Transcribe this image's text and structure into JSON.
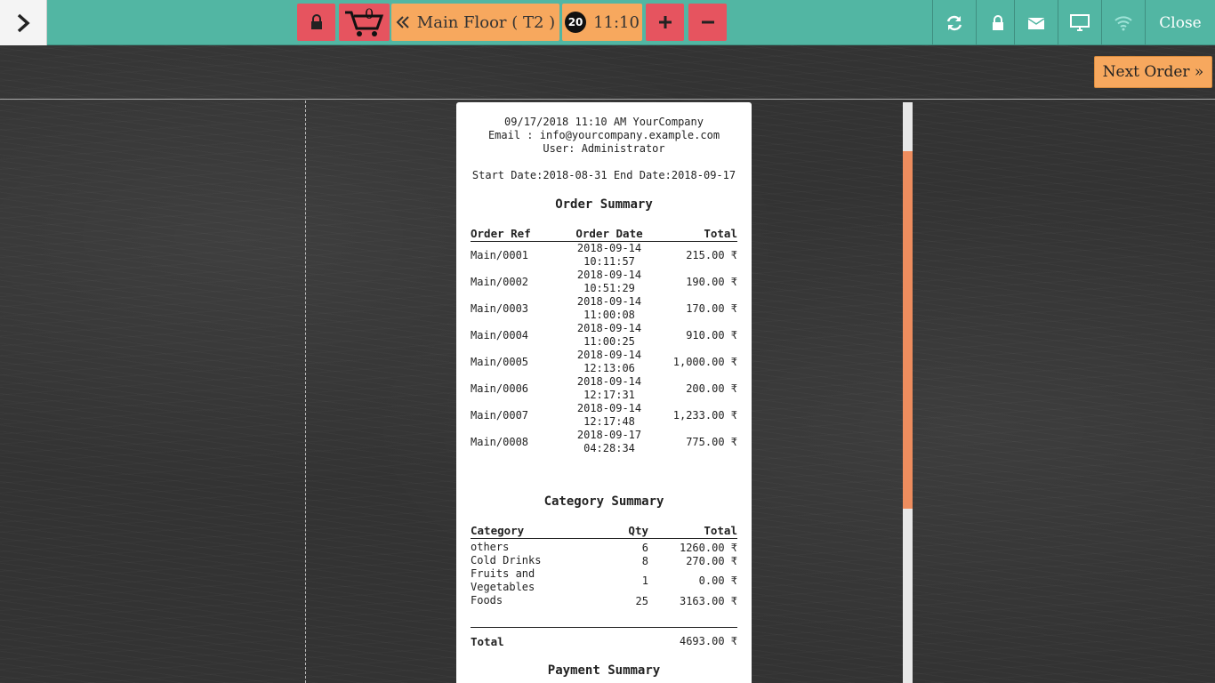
{
  "topbar": {
    "cart_count": "0",
    "floor_label": "Main Floor ( T2 )",
    "badge_number": "20",
    "time": "11:10",
    "close_label": "Close"
  },
  "actions": {
    "next_order_label": "Next Order »"
  },
  "receipt": {
    "header_lines": [
      "09/17/2018 11:10 AM YourCompany",
      "Email : info@yourcompany.example.com",
      "User: Administrator"
    ],
    "date_range": "Start Date:2018-08-31 End Date:2018-09-17",
    "order_summary": {
      "title": "Order Summary",
      "headers": [
        "Order Ref",
        "Order Date",
        "Total"
      ],
      "rows": [
        {
          "ref": "Main/0001",
          "date": "2018-09-14",
          "time": "10:11:57",
          "total": "215.00 ₹"
        },
        {
          "ref": "Main/0002",
          "date": "2018-09-14",
          "time": "10:51:29",
          "total": "190.00 ₹"
        },
        {
          "ref": "Main/0003",
          "date": "2018-09-14",
          "time": "11:00:08",
          "total": "170.00 ₹"
        },
        {
          "ref": "Main/0004",
          "date": "2018-09-14",
          "time": "11:00:25",
          "total": "910.00 ₹"
        },
        {
          "ref": "Main/0005",
          "date": "2018-09-14",
          "time": "12:13:06",
          "total": "1,000.00 ₹"
        },
        {
          "ref": "Main/0006",
          "date": "2018-09-14",
          "time": "12:17:31",
          "total": "200.00 ₹"
        },
        {
          "ref": "Main/0007",
          "date": "2018-09-14",
          "time": "12:17:48",
          "total": "1,233.00 ₹"
        },
        {
          "ref": "Main/0008",
          "date": "2018-09-17",
          "time": "04:28:34",
          "total": "775.00 ₹"
        }
      ]
    },
    "category_summary": {
      "title": "Category Summary",
      "headers": [
        "Category",
        "Qty",
        "Total"
      ],
      "rows": [
        {
          "category": "others",
          "qty": "6",
          "total": "1260.00 ₹"
        },
        {
          "category": "Cold Drinks",
          "qty": "8",
          "total": "270.00 ₹"
        },
        {
          "category": "Fruits and Vegetables",
          "qty": "1",
          "total": "0.00 ₹"
        },
        {
          "category": "Foods",
          "qty": "25",
          "total": "3163.00 ₹"
        }
      ],
      "total_label": "Total",
      "total_value": "4693.00 ₹"
    },
    "payment_summary": {
      "title": "Payment Summary"
    }
  }
}
